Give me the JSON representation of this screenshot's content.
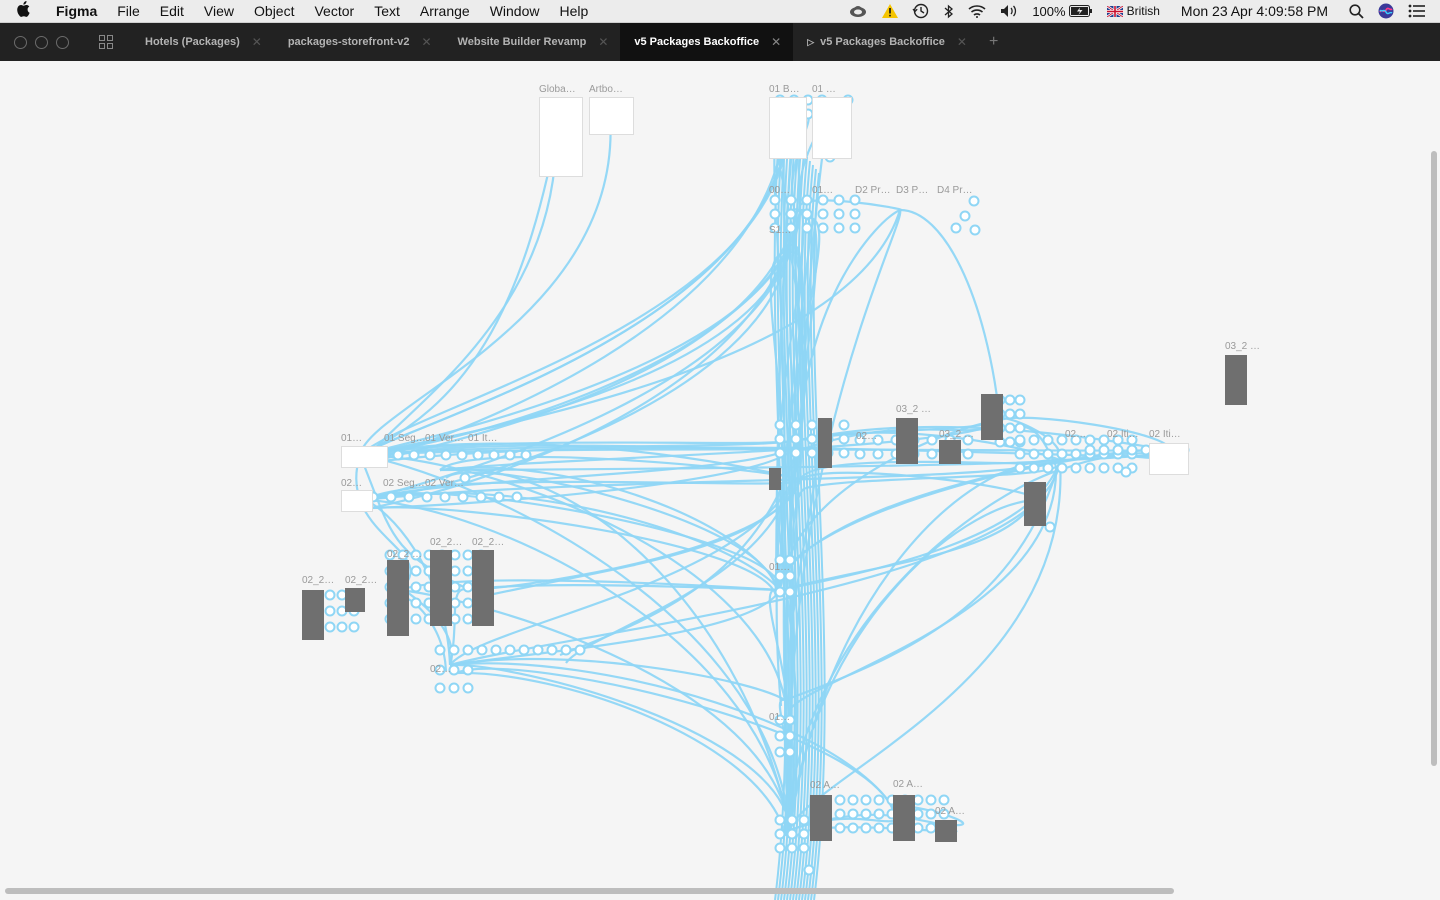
{
  "menubar": {
    "app_name": "Figma",
    "menus": [
      "File",
      "Edit",
      "View",
      "Object",
      "Vector",
      "Text",
      "Arrange",
      "Window",
      "Help"
    ],
    "battery": "100%",
    "input_source": "British",
    "clock": "Mon 23 Apr  4:09:58 PM"
  },
  "tabs": {
    "items": [
      {
        "label": "Hotels (Packages)"
      },
      {
        "label": "packages-storefront-v2"
      },
      {
        "label": "Website Builder Revamp"
      },
      {
        "label": "v5 Packages Backoffice"
      },
      {
        "label": "v5 Packages Backoffice"
      }
    ],
    "active_index": 3,
    "presenting_index": 4
  },
  "canvas": {
    "flow_color": "#8fd6f5",
    "frame_labels": [
      "Globa…",
      "Artbo…",
      "01 B…",
      "01 …",
      "00…",
      "01…",
      "D2 Pr…",
      "D3 P…",
      "D4 Pr…",
      "S1…",
      "03_2 …",
      "03_2 …",
      "01…",
      "01 Seg…",
      "01 Ver…",
      "01 It…",
      "02…",
      "02 Seg…",
      "02 Ver…",
      "02 Iti…",
      "02 Iti…",
      "03_2 …",
      "02…",
      "02…",
      "02_2…",
      "02_2…",
      "02_2 …",
      "02_2…",
      "02_2…",
      "02…",
      "01…",
      "01…",
      "02 A…",
      "02 A…",
      "02 A…"
    ]
  }
}
